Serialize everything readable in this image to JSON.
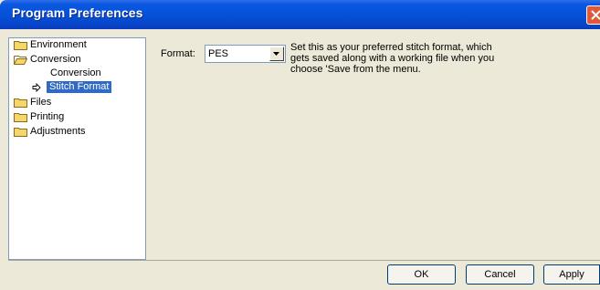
{
  "window": {
    "title": "Program Preferences"
  },
  "tree": {
    "items": [
      {
        "label": "Environment",
        "icon": "folder-icon"
      },
      {
        "label": "Conversion",
        "icon": "folder-open-icon"
      },
      {
        "label": "Conversion",
        "icon": ""
      },
      {
        "label": "Stitch Format",
        "icon": "arrow-right-icon",
        "selected": true
      },
      {
        "label": "Files",
        "icon": "folder-icon"
      },
      {
        "label": "Printing",
        "icon": "folder-icon"
      },
      {
        "label": "Adjustments",
        "icon": "folder-icon"
      }
    ]
  },
  "content": {
    "format_label": "Format:",
    "format_value": "PES",
    "description_lines": [
      "Set this as your preferred stitch format, which",
      "gets saved along with a working file when you",
      "choose 'Save from the menu."
    ]
  },
  "buttons": {
    "ok": "OK",
    "cancel": "Cancel",
    "apply": "Apply"
  },
  "colors": {
    "titlebar": "#0552d9",
    "selection": "#316ac5",
    "dialog_bg": "#ece9d8"
  }
}
